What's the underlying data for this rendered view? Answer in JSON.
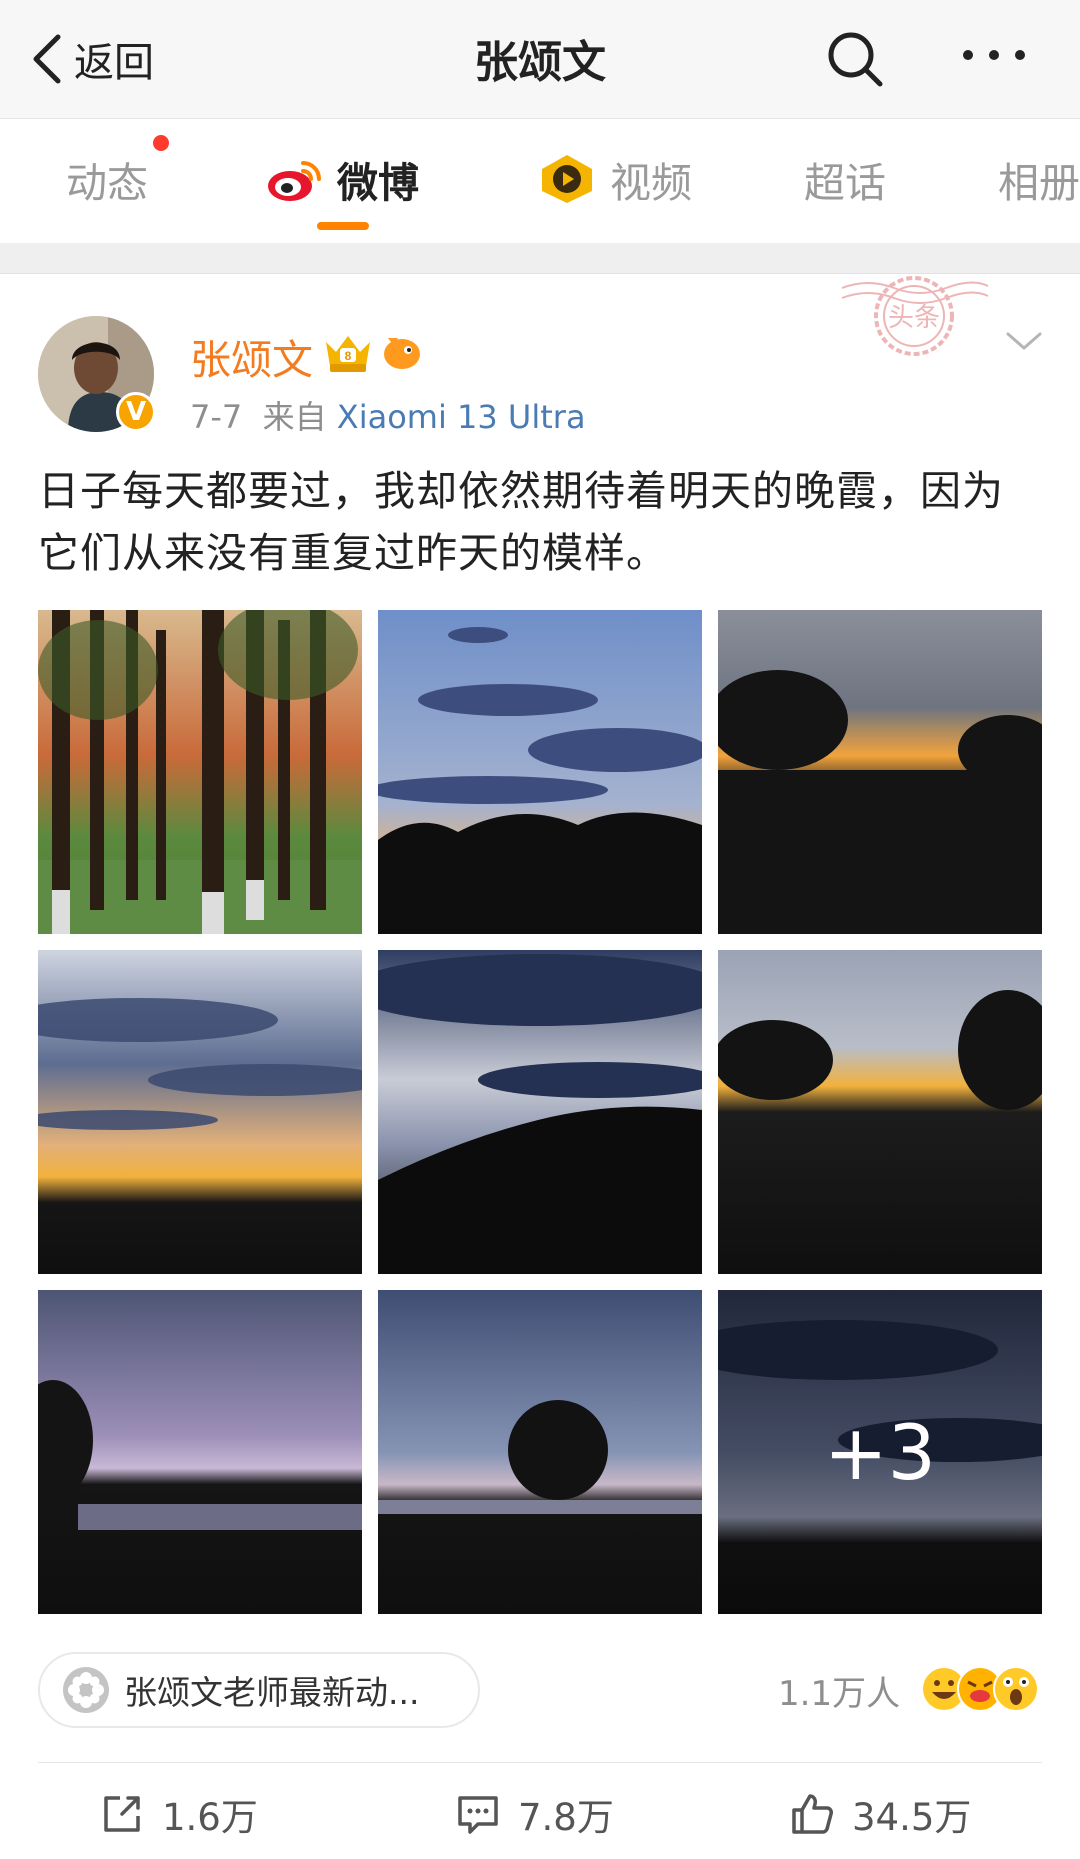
{
  "navbar": {
    "back_label": "返回",
    "title": "张颂文"
  },
  "tabs": [
    {
      "label": "动态",
      "has_dot": true
    },
    {
      "label": "微博",
      "active": true,
      "icon": "weibo-logo-icon"
    },
    {
      "label": "视频",
      "icon": "video-play-icon"
    },
    {
      "label": "超话"
    },
    {
      "label": "相册"
    }
  ],
  "post": {
    "author": "张颂文",
    "date": "7-7",
    "source_prefix": "来自",
    "device": "Xiaomi 13 Ultra",
    "stamp_text": "头条",
    "text": "日子每天都要过，我却依然期待着明天的晚霞，因为它们从来没有重复过昨天的模样。",
    "more_photos": "+3"
  },
  "topic": {
    "label": "张颂文老师最新动..."
  },
  "reactions": {
    "count_label": "1.1万人"
  },
  "actions": {
    "share": "1.6万",
    "comment": "7.8万",
    "like": "34.5万"
  },
  "colors": {
    "accent": "#ff8200",
    "author": "#f47c20",
    "link": "#4a7cb3"
  }
}
